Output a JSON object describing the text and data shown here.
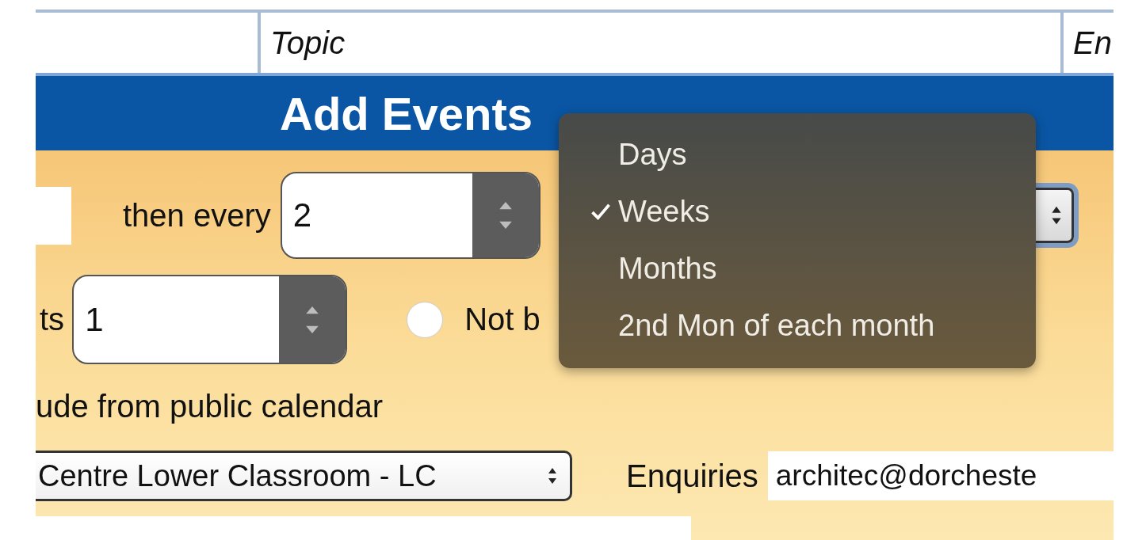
{
  "table_header": {
    "cells": [
      "Topic",
      "En"
    ]
  },
  "panel": {
    "title": "Add Events"
  },
  "repeat_row": {
    "label": "then every",
    "interval": {
      "value": "2"
    }
  },
  "count_row": {
    "label": "ts",
    "count": {
      "value": "1"
    },
    "radio": {
      "label": "Not b",
      "selected": false
    }
  },
  "public_calendar_label": "ude from public calendar",
  "location_select": {
    "value": "Centre Lower Classroom - LC"
  },
  "enquiries": {
    "label": "Enquiries",
    "value": "architec@dorcheste"
  },
  "dropdown_menu": {
    "items": [
      {
        "label": "Days",
        "selected": false
      },
      {
        "label": "Weeks",
        "selected": true
      },
      {
        "label": "Months",
        "selected": false
      },
      {
        "label": "2nd Mon of each month",
        "selected": false
      }
    ]
  }
}
